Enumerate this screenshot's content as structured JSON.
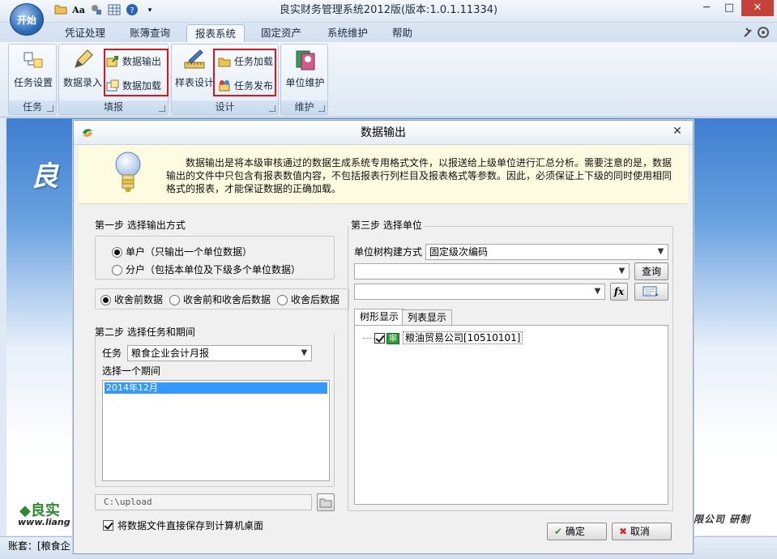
{
  "app": {
    "start_label": "开始",
    "title": "良实财务管理系统2012版(版本:1.0.1.11334)",
    "qat_aa_label": "Aa",
    "menu_tabs": [
      "凭证处理",
      "账簿查询",
      "报表系统",
      "固定资产",
      "系统维护",
      "帮助"
    ],
    "active_tab": "报表系统"
  },
  "ribbon": {
    "groups": [
      {
        "label": "任务",
        "buttons": [
          "任务设置"
        ]
      },
      {
        "label": "填报",
        "buttons": [
          "数据录入",
          "数据输出",
          "数据加载"
        ]
      },
      {
        "label": "设计",
        "buttons": [
          "样表设计",
          "任务加载",
          "任务发布"
        ]
      },
      {
        "label": "维护",
        "buttons": [
          "单位维护"
        ]
      }
    ]
  },
  "background": {
    "logo_char": "良",
    "logo2_text": "良实",
    "logo2_url": "www.liang",
    "company_tail": "限公司  研制"
  },
  "statusbar": {
    "text": "账套：[粮食企"
  },
  "dialog": {
    "title": "数据输出",
    "info": "数据输出是将本级审核通过的数据生成系统专用格式文件，以报送给上级单位进行汇总分析。需要注意的是，数据输出的文件中只包含有报表数值内容，不包括报表行列栏目及报表格式等参数。因此，必须保证上下级的同时使用相同格式的报表，才能保证数据的正确加载。",
    "step1": {
      "title": "第一步  选择输出方式",
      "options": [
        "单户（只输出一个单位数据）",
        "分户（包括本单位及下级多个单位数据）"
      ],
      "selected": 0,
      "close_options": [
        "收舍前数据",
        "收舍前和收舍后数据",
        "收舍后数据"
      ],
      "close_selected": 0
    },
    "step2": {
      "title": "第二步  选择任务和期间",
      "task_label": "任务",
      "task_value": "粮食企业会计月报",
      "period_label": "选择一个期间",
      "periods": [
        "2014年12月"
      ]
    },
    "path": {
      "value": "C:\\upload"
    },
    "save_to_desktop": {
      "label": "将数据文件直接保存到计算机桌面",
      "checked": true
    },
    "step3": {
      "title": "第三步  选择单位",
      "tree_mode_label": "单位树构建方式",
      "tree_mode_value": "固定级次编码",
      "query_button": "查询",
      "fx_label": "fx",
      "tabs": [
        "树形显示",
        "列表显示"
      ],
      "active_tab": "树形显示",
      "tree": [
        {
          "name": "粮油贸易公司[10510101]",
          "checked": true,
          "badge": "审"
        }
      ]
    },
    "ok_button": "确定",
    "cancel_button": "取消"
  }
}
